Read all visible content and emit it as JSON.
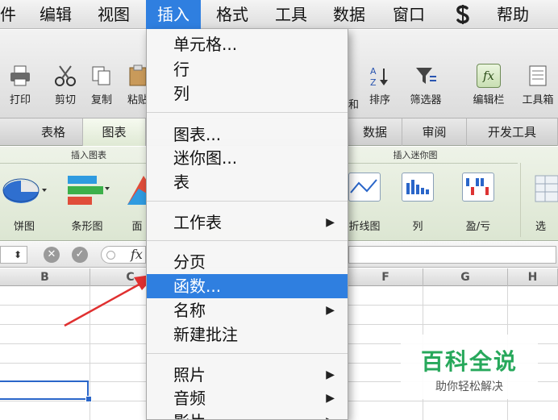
{
  "menubar": {
    "items": [
      "件",
      "编辑",
      "视图",
      "插入",
      "格式",
      "工具",
      "数据",
      "窗口",
      "帮助"
    ],
    "script_icon": "script-s-icon"
  },
  "toolbar": {
    "buttons": [
      "打印",
      "剪切",
      "复制",
      "粘贴",
      "排序",
      "筛选器",
      "编辑栏",
      "工具箱"
    ],
    "sort_left_fragment": "和",
    "fx_label": "fx"
  },
  "ribbon_tabs": [
    "表格",
    "图表",
    "数据",
    "审阅",
    "开发工具"
  ],
  "ribbon": {
    "group_insert_chart": "插入图表",
    "group_insert_sparkline": "插入迷你图",
    "items": [
      "饼图",
      "条形图",
      "面",
      "折线图",
      "列",
      "盈/亏",
      "选"
    ]
  },
  "formula_bar": {
    "fx": "fx",
    "cancel": "✕",
    "confirm": "✓"
  },
  "columns": [
    "B",
    "C",
    "F",
    "G",
    "H"
  ],
  "insert_menu": {
    "items": [
      {
        "label": "单元格...",
        "submenu": false
      },
      {
        "label": "行",
        "submenu": false
      },
      {
        "label": "列",
        "submenu": false
      },
      {
        "label": "图表...",
        "submenu": false
      },
      {
        "label": "迷你图...",
        "submenu": false
      },
      {
        "label": "表",
        "submenu": false
      },
      {
        "label": "工作表",
        "submenu": true
      },
      {
        "label": "分页",
        "submenu": false
      },
      {
        "label": "函数...",
        "submenu": false,
        "highlighted": true
      },
      {
        "label": "名称",
        "submenu": true
      },
      {
        "label": "新建批注",
        "submenu": false
      },
      {
        "label": "照片",
        "submenu": true
      },
      {
        "label": "音频",
        "submenu": true
      },
      {
        "label": "影片",
        "submenu": true
      }
    ],
    "arrow": "▶"
  },
  "watermark": {
    "main": "百科全说",
    "sub": "助你轻松解决"
  },
  "colors": {
    "menu_highlight": "#2f7fe0",
    "annotation_arrow": "#e03030",
    "watermark_green": "#27a85b",
    "selection_blue": "#2a66c9"
  }
}
